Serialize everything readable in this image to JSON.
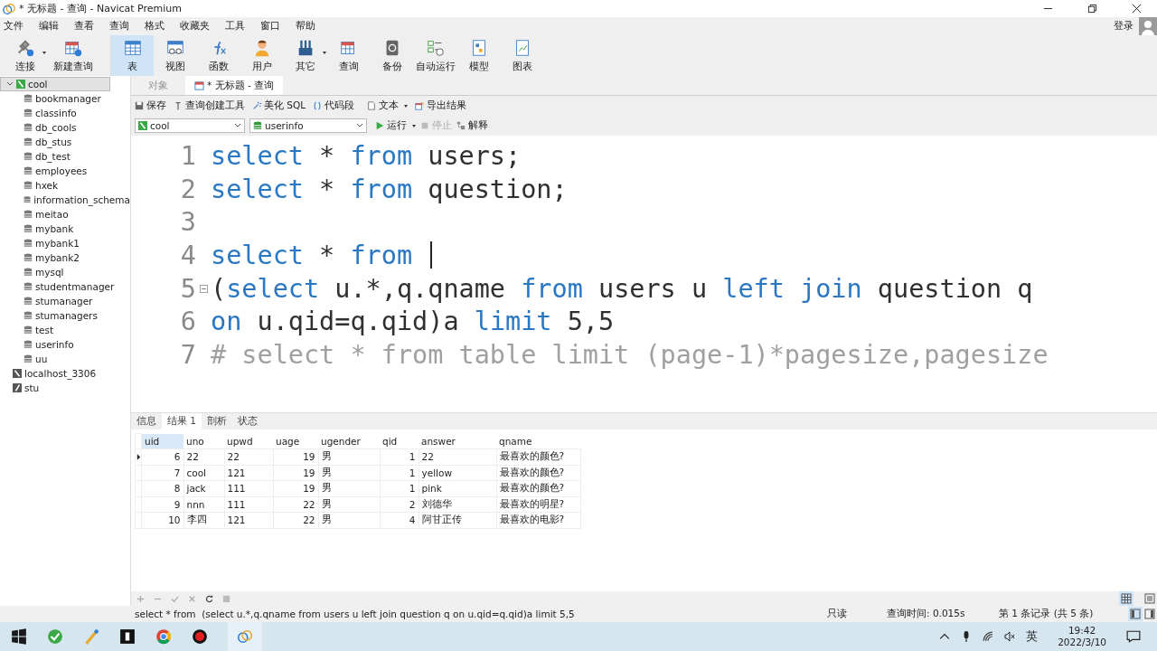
{
  "window": {
    "title": "* 无标题 - 查询 - Navicat Premium"
  },
  "menu": [
    "文件",
    "编辑",
    "查看",
    "查询",
    "格式",
    "收藏夹",
    "工具",
    "窗口",
    "帮助"
  ],
  "login": "登录",
  "toolbar": [
    {
      "label": "连接",
      "selected": false,
      "dropdown": true
    },
    {
      "label": "新建查询",
      "selected": false,
      "dropdown": false
    },
    {
      "label": "表",
      "selected": true,
      "dropdown": false
    },
    {
      "label": "视图",
      "selected": false,
      "dropdown": false
    },
    {
      "label": "函数",
      "selected": false,
      "dropdown": false
    },
    {
      "label": "用户",
      "selected": false,
      "dropdown": false
    },
    {
      "label": "其它",
      "selected": false,
      "dropdown": true
    },
    {
      "label": "查询",
      "selected": false,
      "dropdown": false
    },
    {
      "label": "备份",
      "selected": false,
      "dropdown": false
    },
    {
      "label": "自动运行",
      "selected": false,
      "dropdown": false
    },
    {
      "label": "模型",
      "selected": false,
      "dropdown": false
    },
    {
      "label": "图表",
      "selected": false,
      "dropdown": false
    }
  ],
  "sidebar": {
    "items": [
      {
        "label": "cool",
        "kind": "connection",
        "selected": true,
        "expanded": true,
        "children": [
          {
            "label": "bookmanager",
            "kind": "database",
            "selected": false
          },
          {
            "label": "classinfo",
            "kind": "database",
            "selected": false
          },
          {
            "label": "db_cools",
            "kind": "database",
            "selected": false
          },
          {
            "label": "db_stus",
            "kind": "database",
            "selected": false
          },
          {
            "label": "db_test",
            "kind": "database",
            "selected": false
          },
          {
            "label": "employees",
            "kind": "database",
            "selected": false
          },
          {
            "label": "hxek",
            "kind": "database",
            "selected": false
          },
          {
            "label": "information_schema",
            "kind": "database",
            "selected": false
          },
          {
            "label": "meitao",
            "kind": "database",
            "selected": false
          },
          {
            "label": "mybank",
            "kind": "database",
            "selected": false
          },
          {
            "label": "mybank1",
            "kind": "database",
            "selected": false
          },
          {
            "label": "mybank2",
            "kind": "database",
            "selected": false
          },
          {
            "label": "mysql",
            "kind": "database",
            "selected": false
          },
          {
            "label": "studentmanager",
            "kind": "database",
            "selected": false
          },
          {
            "label": "stumanager",
            "kind": "database",
            "selected": false
          },
          {
            "label": "stumanagers",
            "kind": "database",
            "selected": false
          },
          {
            "label": "test",
            "kind": "database",
            "selected": false
          },
          {
            "label": "userinfo",
            "kind": "database",
            "selected": false
          },
          {
            "label": "uu",
            "kind": "database",
            "selected": false
          }
        ]
      },
      {
        "label": "localhost_3306",
        "kind": "connection",
        "selected": false,
        "expanded": false
      },
      {
        "label": "stu",
        "kind": "file",
        "selected": false,
        "expanded": false
      }
    ]
  },
  "tabs": [
    {
      "label": "对象",
      "selected": false
    },
    {
      "label": "* 无标题 - 查询",
      "selected": true
    }
  ],
  "query_toolbar": [
    {
      "label": "保存",
      "dropdown": false
    },
    {
      "label": "查询创建工具",
      "dropdown": false
    },
    {
      "label": "美化 SQL",
      "dropdown": false
    },
    {
      "label": "代码段",
      "dropdown": false
    },
    {
      "label": "文本",
      "dropdown": true
    },
    {
      "label": "导出结果",
      "dropdown": false
    }
  ],
  "connection_select": {
    "value": "cool"
  },
  "database_select": {
    "value": "userinfo"
  },
  "run_buttons": [
    {
      "label": "运行",
      "disabled": false,
      "dropdown": true
    },
    {
      "label": "停止",
      "disabled": true,
      "dropdown": false
    },
    {
      "label": "解释",
      "disabled": false,
      "dropdown": false
    }
  ],
  "editor": {
    "lines": [
      {
        "number": "1",
        "tokens": [
          {
            "kind": "keyword",
            "text": "select"
          },
          {
            "kind": "plain",
            "text": " * "
          },
          {
            "kind": "keyword",
            "text": "from"
          },
          {
            "kind": "plain",
            "text": " users;"
          }
        ]
      },
      {
        "number": "2",
        "tokens": [
          {
            "kind": "keyword",
            "text": "select"
          },
          {
            "kind": "plain",
            "text": " * "
          },
          {
            "kind": "keyword",
            "text": "from"
          },
          {
            "kind": "plain",
            "text": " question;"
          }
        ]
      },
      {
        "number": "3"
      },
      {
        "number": "4",
        "cursor": true,
        "tokens": [
          {
            "kind": "keyword",
            "text": "select"
          },
          {
            "kind": "plain",
            "text": " * "
          },
          {
            "kind": "keyword",
            "text": "from"
          }
        ]
      },
      {
        "number": "5",
        "foldable": true,
        "tokens": [
          {
            "kind": "plain",
            "text": "("
          },
          {
            "kind": "keyword",
            "text": "select"
          },
          {
            "kind": "plain",
            "text": " u.*,q.qname "
          },
          {
            "kind": "keyword",
            "text": "from"
          },
          {
            "kind": "plain",
            "text": " users u "
          },
          {
            "kind": "keyword",
            "text": "left join"
          },
          {
            "kind": "plain",
            "text": " question q"
          }
        ]
      },
      {
        "number": "6",
        "tokens": [
          {
            "kind": "keyword",
            "text": "on"
          },
          {
            "kind": "plain",
            "text": " u.qid=q.qid)a "
          },
          {
            "kind": "keyword",
            "text": "limit"
          },
          {
            "kind": "plain",
            "text": " 5,5"
          }
        ]
      },
      {
        "number": "7",
        "tokens": [
          {
            "kind": "comment",
            "text": "# select * from table limit (page-1)*pagesize,pagesize"
          }
        ]
      }
    ]
  },
  "result_tabs": [
    {
      "label": "信息",
      "selected": false
    },
    {
      "label": "结果 1",
      "selected": true
    },
    {
      "label": "剖析",
      "selected": false
    },
    {
      "label": "状态",
      "selected": false
    }
  ],
  "table": {
    "columns": [
      {
        "label": "uid",
        "selected": true
      },
      {
        "label": "uno",
        "selected": false
      },
      {
        "label": "upwd",
        "selected": false
      },
      {
        "label": "uage",
        "selected": false
      },
      {
        "label": "ugender",
        "selected": false
      },
      {
        "label": "qid",
        "selected": false
      },
      {
        "label": "answer",
        "selected": false
      },
      {
        "label": "qname",
        "selected": false
      }
    ],
    "rows": [
      {
        "current": true,
        "cells": [
          "6",
          "22",
          "22",
          "19",
          "男",
          "1",
          "22",
          "最喜欢的颜色?"
        ]
      },
      {
        "current": false,
        "cells": [
          "7",
          "cool",
          "121",
          "19",
          "男",
          "1",
          "yellow",
          "最喜欢的颜色?"
        ]
      },
      {
        "current": false,
        "cells": [
          "8",
          "jack",
          "111",
          "19",
          "男",
          "1",
          "pink",
          "最喜欢的颜色?"
        ]
      },
      {
        "current": false,
        "cells": [
          "9",
          "nnn",
          "111",
          "22",
          "男",
          "2",
          "刘德华",
          "最喜欢的明星?"
        ]
      },
      {
        "current": false,
        "cells": [
          "10",
          "李四",
          "121",
          "22",
          "男",
          "4",
          "阿甘正传",
          "最喜欢的电影?"
        ]
      }
    ]
  },
  "status_bar": {
    "sql": "select * from  (select u.*,q.qname from users u left join question q on u.qid=q.qid)a limit 5,5",
    "mode": "只读",
    "query_time": "查询时间: 0.015s",
    "record": "第 1 条记录 (共 5 条)"
  },
  "taskbar": {
    "ime": "英",
    "time": "19:42",
    "date": "2022/3/10"
  }
}
